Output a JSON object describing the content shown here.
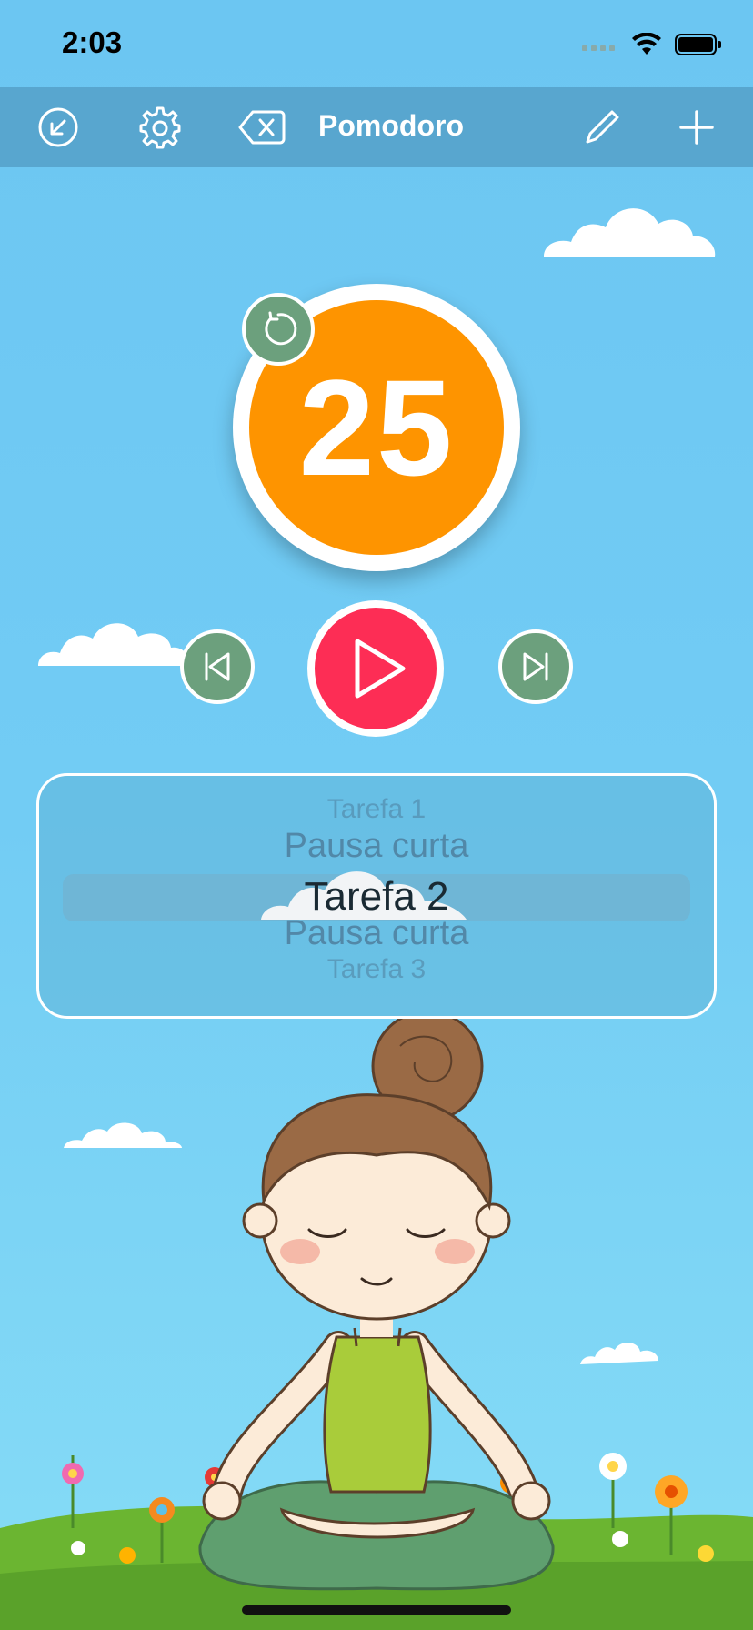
{
  "status": {
    "time": "2:03"
  },
  "toolbar": {
    "title": "Pomodoro",
    "icons": [
      "collapse-icon",
      "gear-icon",
      "delete-icon",
      "pencil-icon",
      "plus-icon"
    ]
  },
  "timer": {
    "minutes": "25"
  },
  "picker": {
    "items": [
      "Tarefa 1",
      "Pausa curta",
      "Tarefa 2",
      "Pausa curta",
      "Tarefa 3"
    ],
    "selected_index": 2
  },
  "colors": {
    "timer": "#fe9400",
    "play": "#fd2d55",
    "controls": "#6ca07d",
    "toolbar": "#58a6cf"
  }
}
